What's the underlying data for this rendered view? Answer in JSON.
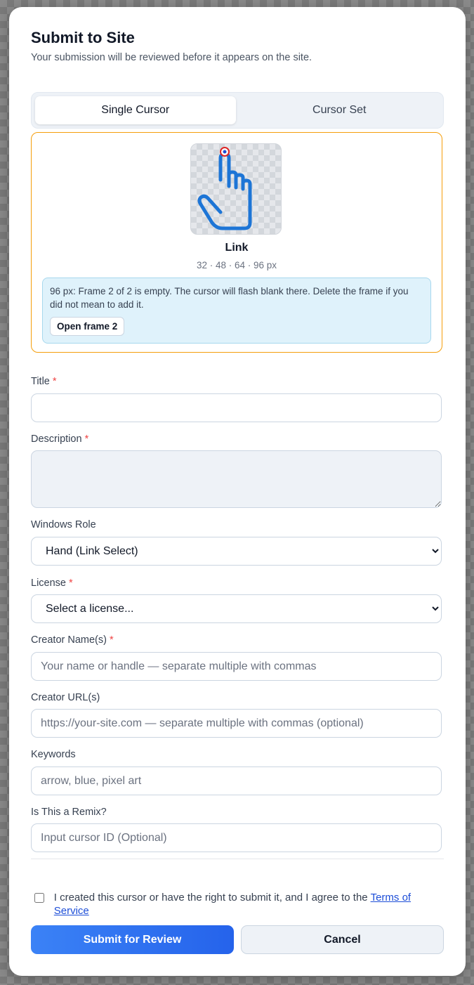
{
  "dialog": {
    "title": "Submit to Site",
    "subtitle": "Your submission will be reviewed before it appears on the site."
  },
  "tabs": [
    {
      "label": "Single Cursor",
      "active": true
    },
    {
      "label": "Cursor Set",
      "active": false
    }
  ],
  "preview": {
    "cursor_name": "Link",
    "sizes": "32 · 48 · 64 · 96 px",
    "icon": "hand-pointer-icon",
    "warning": "96 px: Frame 2 of 2 is empty. The cursor will flash blank there. Delete the frame if you did not mean to add it.",
    "open_frame_label": "Open frame 2"
  },
  "form": {
    "required_mark": "*",
    "title_label": "Title",
    "title_value": "",
    "description_label": "Description",
    "description_value": "",
    "windows_role_label": "Windows Role",
    "windows_role_value": "Hand (Link Select)",
    "license_label": "License",
    "license_value": "Select a license...",
    "creator_names_label": "Creator Name(s)",
    "creator_names_placeholder": "Your name or handle — separate multiple with commas",
    "creator_urls_label": "Creator URL(s)",
    "creator_urls_placeholder": "https://your-site.com — separate multiple with commas (optional)",
    "keywords_label": "Keywords",
    "keywords_placeholder": "arrow, blue, pixel art",
    "remix_label": "Is This a Remix?",
    "remix_placeholder": "Input cursor ID (Optional)"
  },
  "agreement": {
    "text": "I created this cursor or have the right to submit it, and I agree to the ",
    "link": "Terms of Service",
    "checked": false
  },
  "actions": {
    "submit_label": "Submit for Review",
    "cancel_label": "Cancel"
  },
  "colors": {
    "accent": "#2563eb",
    "preview_border": "#f59e0b",
    "cursor_blue": "#1d75d6",
    "required": "#ef4444"
  }
}
